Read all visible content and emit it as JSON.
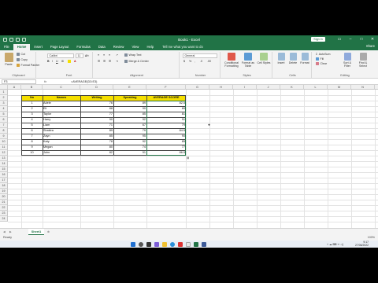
{
  "window": {
    "title": "Book1 - Excel",
    "sign_in": "Sign in",
    "share": "Share"
  },
  "ribbon_tabs": [
    "File",
    "Home",
    "Insert",
    "Page Layout",
    "Formulas",
    "Data",
    "Review",
    "View",
    "Help"
  ],
  "tell_me": "Tell me what you want to do",
  "ribbon": {
    "clipboard": {
      "paste": "Paste",
      "cut": "Cut",
      "copy": "Copy",
      "format_painter": "Format Painter",
      "label": "Clipboard"
    },
    "font": {
      "name": "Calibri",
      "size": "11",
      "label": "Font"
    },
    "alignment": {
      "wrap": "Wrap Text",
      "merge": "Merge & Center",
      "label": "Alignment"
    },
    "number": {
      "format": "General",
      "label": "Number"
    },
    "styles": {
      "conditional": "Conditional Formatting",
      "table": "Format as Table",
      "cell": "Cell Styles",
      "label": "Styles"
    },
    "cells": {
      "insert": "Insert",
      "delete": "Delete",
      "format": "Format",
      "label": "Cells"
    },
    "editing": {
      "autosum": "AutoSum",
      "fill": "Fill",
      "clear": "Clear",
      "sort": "Sort & Filter",
      "find": "Find & Select",
      "label": "Editing"
    }
  },
  "formula_bar": {
    "name_box": "F3",
    "fx": "fx",
    "formula": "=AVERAGE(D3:E3)"
  },
  "columns": [
    "A",
    "B",
    "C",
    "D",
    "E",
    "F",
    "G",
    "H",
    "I",
    "J",
    "K",
    "L",
    "M",
    "N",
    "O"
  ],
  "rows": [
    "1",
    "2",
    "3",
    "4",
    "5",
    "6",
    "7",
    "8",
    "9",
    "10",
    "11",
    "12",
    "13",
    "14",
    "15",
    "16",
    "17",
    "18",
    "19",
    "20",
    "21",
    "22",
    "23",
    "24"
  ],
  "table": {
    "headers": [
      "No",
      "Names",
      "Writing",
      "Speaking",
      "AVERAGE SCORE"
    ],
    "rows": [
      [
        "1",
        "Adele",
        "76",
        "89",
        "82.5"
      ],
      [
        "2",
        "Eli",
        "88",
        "90",
        "89"
      ],
      [
        "3",
        "Taylor",
        "77",
        "85",
        "81"
      ],
      [
        "4",
        "Harry",
        "90",
        "92",
        "91"
      ],
      [
        "5",
        "Liam",
        "71",
        "67",
        "79"
      ],
      [
        "6",
        "Shakira",
        "89",
        "79",
        "84.5"
      ],
      [
        "7",
        "Zayn",
        "85",
        "95",
        "90"
      ],
      [
        "8",
        "Katy",
        "78",
        "92",
        "85"
      ],
      [
        "9",
        "Megan",
        "80",
        "74",
        "77"
      ],
      [
        "10",
        "John",
        "82",
        "91",
        "86.5"
      ]
    ]
  },
  "sheet_tab": "Sheet1",
  "status": "Ready",
  "zoom": "100%",
  "clock": {
    "time": "9:17",
    "date": "27/06/2022"
  },
  "colors": {
    "excel_green": "#217346",
    "header_yellow": "#f5df00"
  }
}
